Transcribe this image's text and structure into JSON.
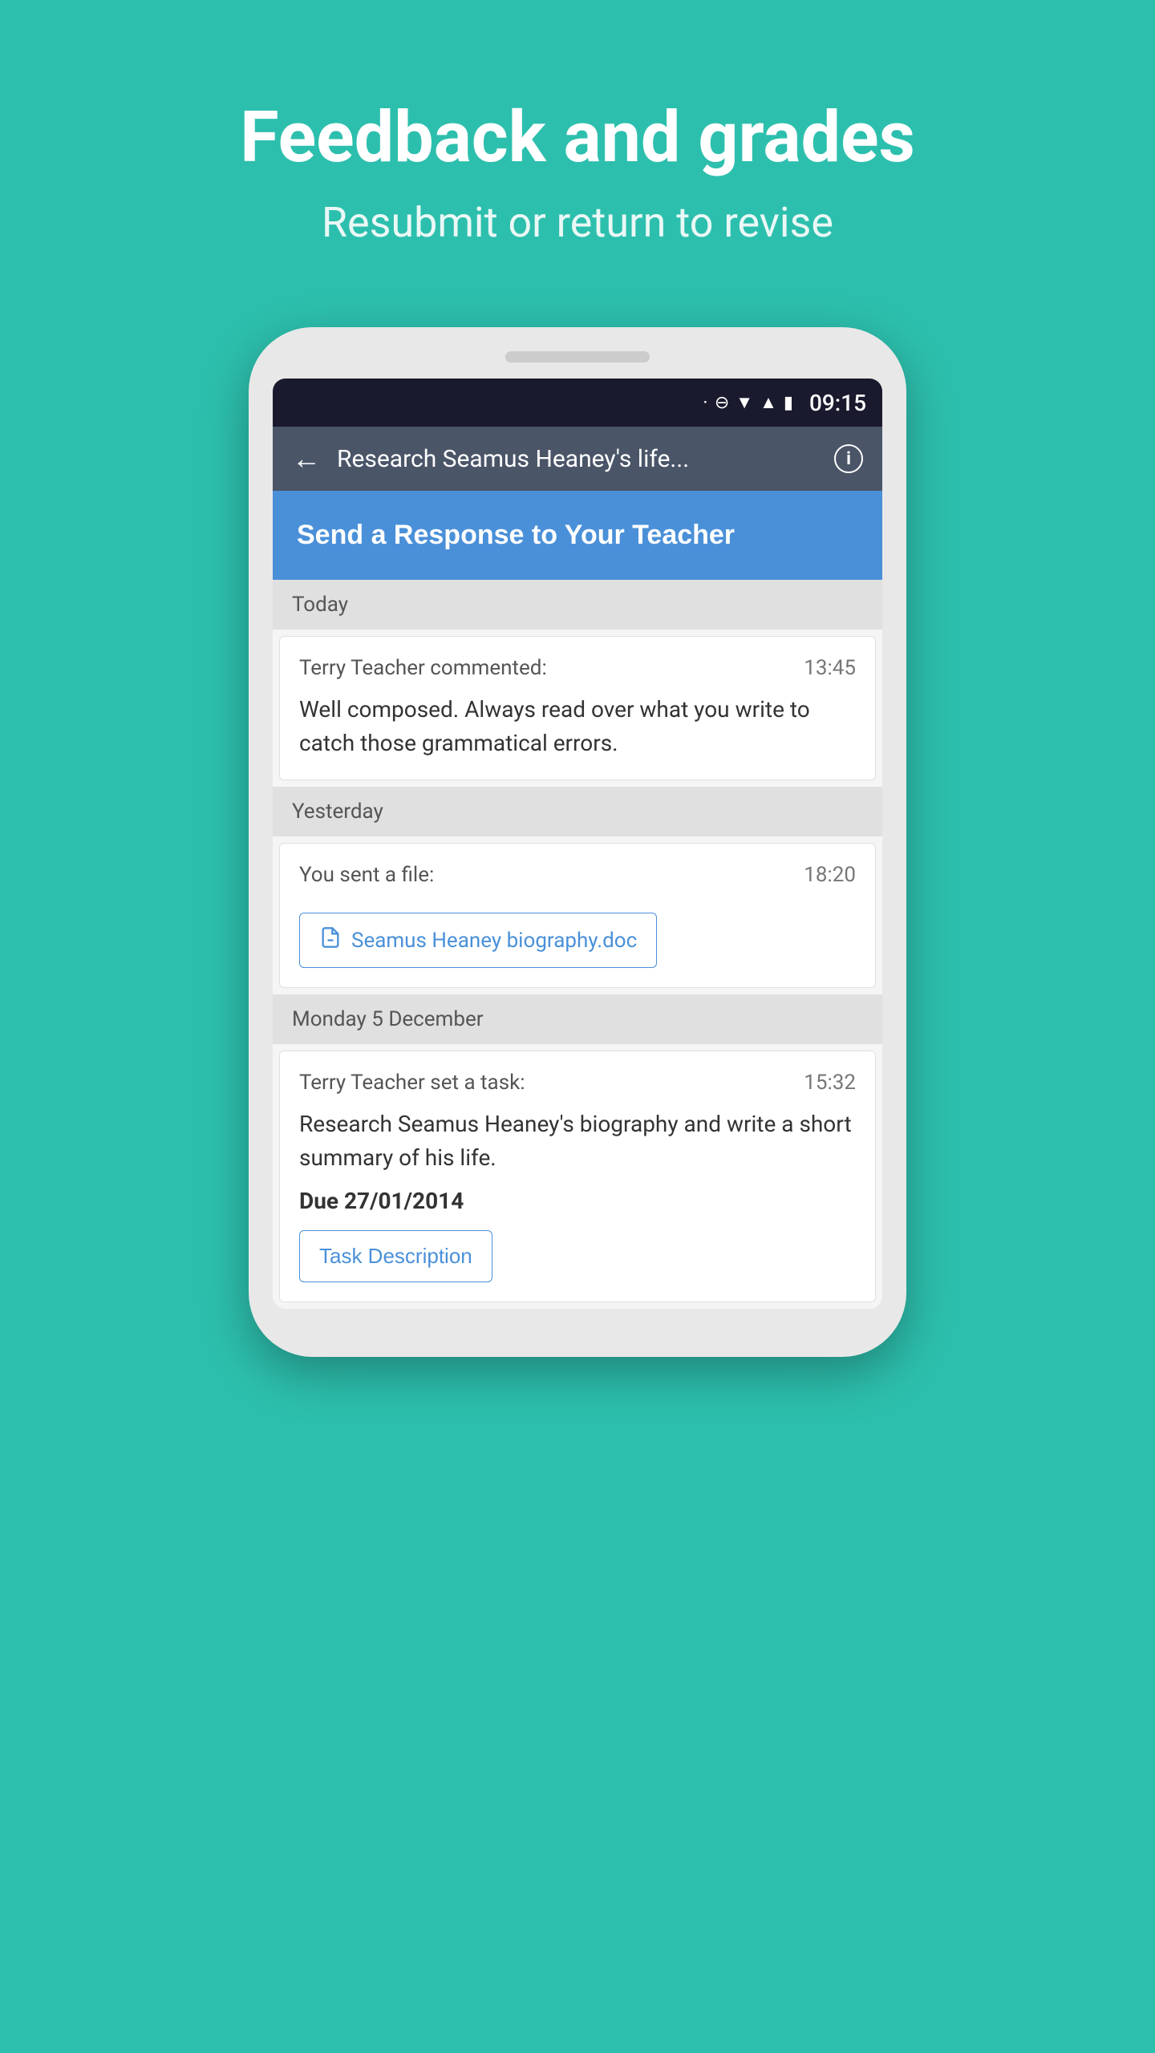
{
  "page": {
    "title": "Feedback and grades",
    "subtitle": "Resubmit or return to revise",
    "background_color": "#2dbfad"
  },
  "status_bar": {
    "time": "09:15",
    "icons": [
      "bluetooth",
      "block",
      "wifi",
      "signal",
      "battery"
    ]
  },
  "app_header": {
    "title": "Research Seamus Heaney's life...",
    "back_label": "←",
    "info_label": "i"
  },
  "send_response": {
    "label": "Send a Response to Your Teacher"
  },
  "sections": [
    {
      "id": "today",
      "label": "Today",
      "messages": [
        {
          "sender": "Terry Teacher commented:",
          "time": "13:45",
          "text": "Well composed. Always read over what you write to catch those grammatical errors.",
          "type": "comment"
        }
      ]
    },
    {
      "id": "yesterday",
      "label": "Yesterday",
      "messages": [
        {
          "sender": "You sent a file:",
          "time": "18:20",
          "type": "file",
          "file_name": "Seamus Heaney biography.doc"
        }
      ]
    },
    {
      "id": "monday",
      "label": "Monday 5 December",
      "messages": [
        {
          "sender": "Terry Teacher set a task:",
          "time": "15:32",
          "type": "task",
          "text": "Research Seamus Heaney's biography and write a short summary of his life.",
          "due_date": "Due 27/01/2014",
          "task_desc_label": "Task Description"
        }
      ]
    }
  ]
}
